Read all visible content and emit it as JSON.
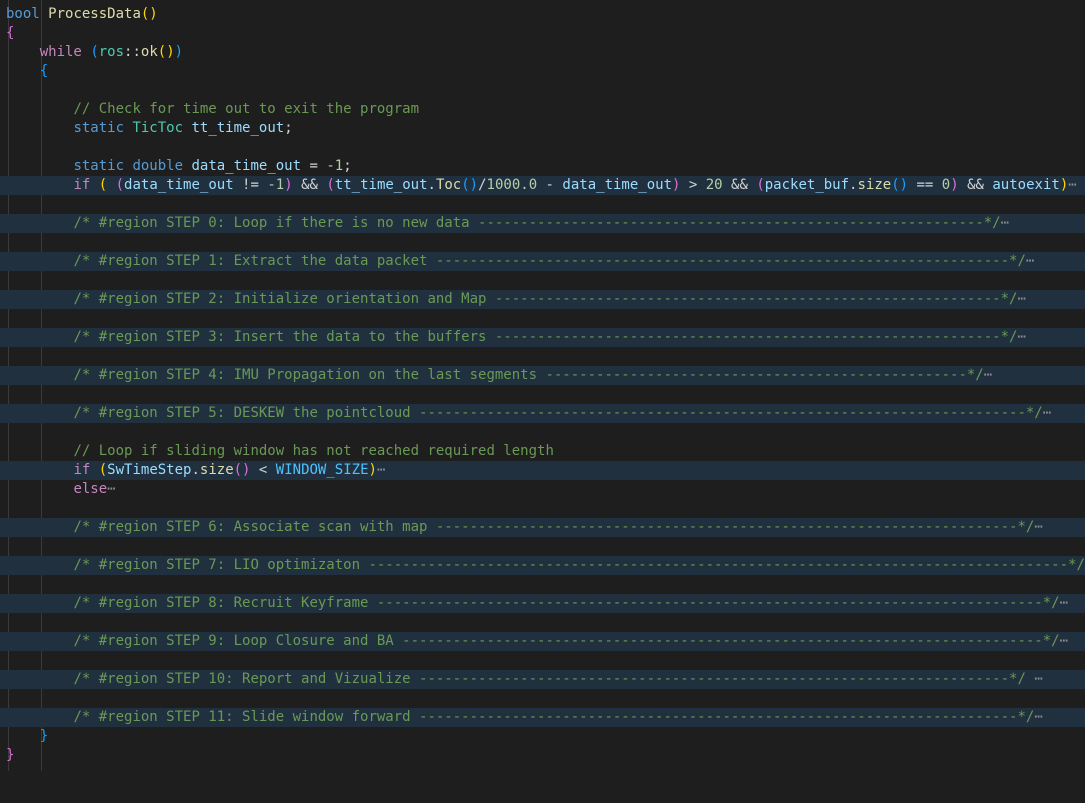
{
  "code": {
    "fn_type": "bool",
    "fn_name": "ProcessData",
    "while_kw": "while",
    "ns": "ros",
    "ok_fn": "ok",
    "comment_timeout": "// Check for time out to exit the program",
    "static_kw": "static",
    "tictoc_type": "TicToc",
    "tt_var": "tt_time_out",
    "double_kw": "double",
    "dt_var": "data_time_out",
    "neg_one": "-1",
    "if_kw": "if",
    "toc_fn": "Toc",
    "num_1000": "1000.0",
    "num_20": "20",
    "packet_var": "packet_buf",
    "size_fn": "size",
    "num_0": "0",
    "autoexit_var": "autoexit",
    "comment_window": "// Loop if sliding window has not reached required length",
    "sw_var": "SwTimeStep",
    "window_const": "WINDOW_SIZE",
    "else_kw": "else",
    "fold_marker": "⋯"
  },
  "regions": [
    "/* #region STEP 0: Loop if there is no new data ------------------------------------------------------------*/",
    "/* #region STEP 1: Extract the data packet --------------------------------------------------------------------*/",
    "/* #region STEP 2: Initialize orientation and Map ------------------------------------------------------------*/",
    "/* #region STEP 3: Insert the data to the buffers ------------------------------------------------------------*/",
    "/* #region STEP 4: IMU Propagation on the last segments --------------------------------------------------*/",
    "/* #region STEP 5: DESKEW the pointcloud ------------------------------------------------------------------------*/",
    "/* #region STEP 6: Associate scan with map ---------------------------------------------------------------------*/",
    "/* #region STEP 7: LIO optimizaton -----------------------------------------------------------------------------------*/",
    "/* #region STEP 8: Recruit Keyframe -------------------------------------------------------------------------------*/",
    "/* #region STEP 9: Loop Closure and BA ----------------------------------------------------------------------------*/",
    "/* #region STEP 10: Report and Vizualize ----------------------------------------------------------------------*/",
    "/* #region STEP 11: Slide window forward -----------------------------------------------------------------------*/"
  ]
}
